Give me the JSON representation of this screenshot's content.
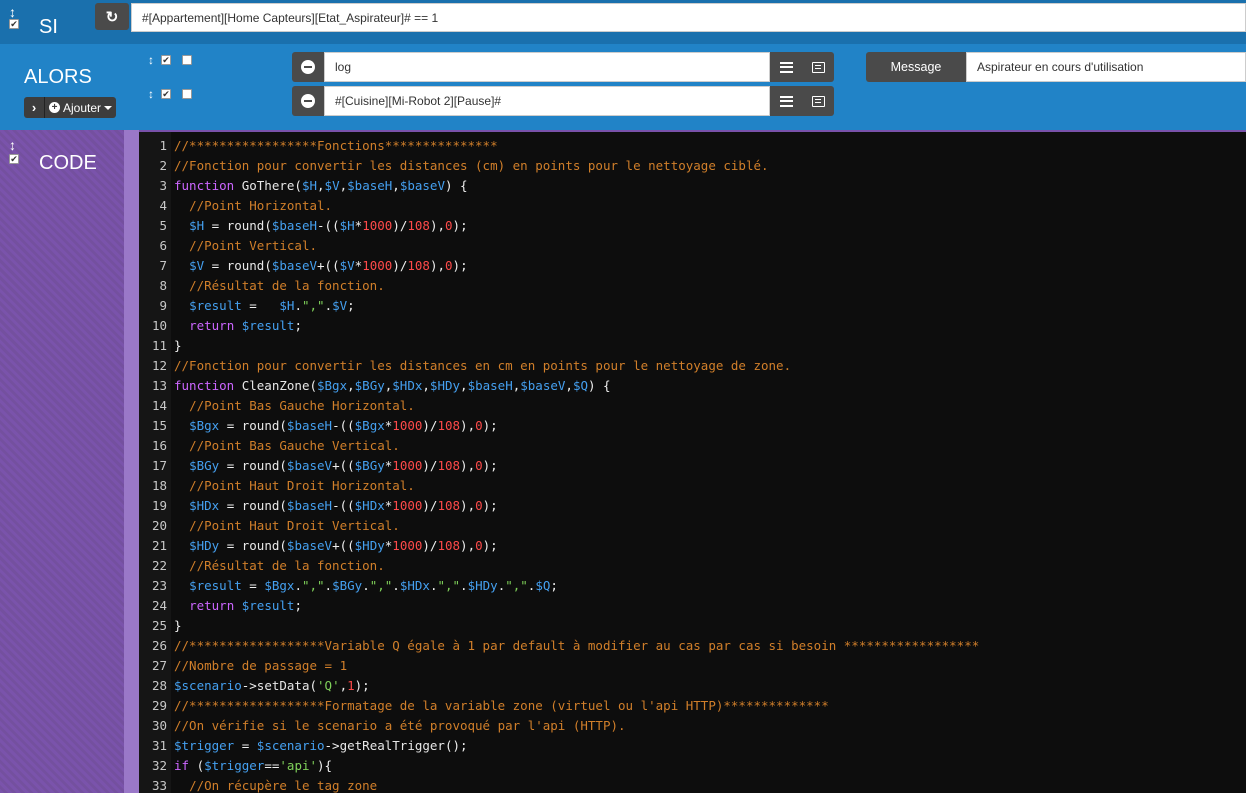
{
  "si": {
    "title": "SI",
    "condition": "#[Appartement][Home Capteurs][Etat_Aspirateur]# == 1"
  },
  "alors": {
    "title": "ALORS",
    "add_label": "Ajouter",
    "actions": [
      {
        "value": "log",
        "option_label": "Message",
        "option_value": "Aspirateur en cours d'utilisation"
      },
      {
        "value": "#[Cuisine][Mi-Robot 2][Pause]#"
      }
    ]
  },
  "code": {
    "title": "CODE",
    "lines": [
      [
        [
          "c",
          "//*****************Fonctions***************"
        ]
      ],
      [
        [
          "c",
          "//Fonction pour convertir les distances (cm) en points pour le nettoyage ciblé."
        ]
      ],
      [
        [
          "k",
          "function "
        ],
        [
          "f",
          "GoThere"
        ],
        [
          "p",
          "("
        ],
        [
          "v",
          "$H"
        ],
        [
          "p",
          ","
        ],
        [
          "v",
          "$V"
        ],
        [
          "p",
          ","
        ],
        [
          "v",
          "$baseH"
        ],
        [
          "p",
          ","
        ],
        [
          "v",
          "$baseV"
        ],
        [
          "p",
          ") {"
        ]
      ],
      [
        [
          "p",
          "  "
        ],
        [
          "c",
          "//Point Horizontal."
        ]
      ],
      [
        [
          "p",
          "  "
        ],
        [
          "v",
          "$H"
        ],
        [
          "p",
          " = "
        ],
        [
          "f",
          "round"
        ],
        [
          "p",
          "("
        ],
        [
          "v",
          "$baseH"
        ],
        [
          "p",
          "-(("
        ],
        [
          "v",
          "$H"
        ],
        [
          "p",
          "*"
        ],
        [
          "n",
          "1000"
        ],
        [
          "p",
          ")/"
        ],
        [
          "n",
          "108"
        ],
        [
          "p",
          "),"
        ],
        [
          "n",
          "0"
        ],
        [
          "p",
          ");"
        ]
      ],
      [
        [
          "p",
          "  "
        ],
        [
          "c",
          "//Point Vertical."
        ]
      ],
      [
        [
          "p",
          "  "
        ],
        [
          "v",
          "$V"
        ],
        [
          "p",
          " = "
        ],
        [
          "f",
          "round"
        ],
        [
          "p",
          "("
        ],
        [
          "v",
          "$baseV"
        ],
        [
          "p",
          "+(("
        ],
        [
          "v",
          "$V"
        ],
        [
          "p",
          "*"
        ],
        [
          "n",
          "1000"
        ],
        [
          "p",
          ")/"
        ],
        [
          "n",
          "108"
        ],
        [
          "p",
          "),"
        ],
        [
          "n",
          "0"
        ],
        [
          "p",
          ");"
        ]
      ],
      [
        [
          "p",
          "  "
        ],
        [
          "c",
          "//Résultat de la fonction."
        ]
      ],
      [
        [
          "p",
          "  "
        ],
        [
          "v",
          "$result"
        ],
        [
          "p",
          " =   "
        ],
        [
          "v",
          "$H"
        ],
        [
          "p",
          "."
        ],
        [
          "s",
          "\",\""
        ],
        [
          "p",
          "."
        ],
        [
          "v",
          "$V"
        ],
        [
          "p",
          ";"
        ]
      ],
      [
        [
          "p",
          "  "
        ],
        [
          "k",
          "return "
        ],
        [
          "v",
          "$result"
        ],
        [
          "p",
          ";"
        ]
      ],
      [
        [
          "p",
          "}"
        ]
      ],
      [
        [
          "c",
          "//Fonction pour convertir les distances en cm en points pour le nettoyage de zone."
        ]
      ],
      [
        [
          "k",
          "function "
        ],
        [
          "f",
          "CleanZone"
        ],
        [
          "p",
          "("
        ],
        [
          "v",
          "$Bgx"
        ],
        [
          "p",
          ","
        ],
        [
          "v",
          "$BGy"
        ],
        [
          "p",
          ","
        ],
        [
          "v",
          "$HDx"
        ],
        [
          "p",
          ","
        ],
        [
          "v",
          "$HDy"
        ],
        [
          "p",
          ","
        ],
        [
          "v",
          "$baseH"
        ],
        [
          "p",
          ","
        ],
        [
          "v",
          "$baseV"
        ],
        [
          "p",
          ","
        ],
        [
          "v",
          "$Q"
        ],
        [
          "p",
          ") {"
        ]
      ],
      [
        [
          "p",
          "  "
        ],
        [
          "c",
          "//Point Bas Gauche Horizontal."
        ]
      ],
      [
        [
          "p",
          "  "
        ],
        [
          "v",
          "$Bgx"
        ],
        [
          "p",
          " = "
        ],
        [
          "f",
          "round"
        ],
        [
          "p",
          "("
        ],
        [
          "v",
          "$baseH"
        ],
        [
          "p",
          "-(("
        ],
        [
          "v",
          "$Bgx"
        ],
        [
          "p",
          "*"
        ],
        [
          "n",
          "1000"
        ],
        [
          "p",
          ")/"
        ],
        [
          "n",
          "108"
        ],
        [
          "p",
          "),"
        ],
        [
          "n",
          "0"
        ],
        [
          "p",
          ");"
        ]
      ],
      [
        [
          "p",
          "  "
        ],
        [
          "c",
          "//Point Bas Gauche Vertical."
        ]
      ],
      [
        [
          "p",
          "  "
        ],
        [
          "v",
          "$BGy"
        ],
        [
          "p",
          " = "
        ],
        [
          "f",
          "round"
        ],
        [
          "p",
          "("
        ],
        [
          "v",
          "$baseV"
        ],
        [
          "p",
          "+(("
        ],
        [
          "v",
          "$BGy"
        ],
        [
          "p",
          "*"
        ],
        [
          "n",
          "1000"
        ],
        [
          "p",
          ")/"
        ],
        [
          "n",
          "108"
        ],
        [
          "p",
          "),"
        ],
        [
          "n",
          "0"
        ],
        [
          "p",
          ");"
        ]
      ],
      [
        [
          "p",
          "  "
        ],
        [
          "c",
          "//Point Haut Droit Horizontal."
        ]
      ],
      [
        [
          "p",
          "  "
        ],
        [
          "v",
          "$HDx"
        ],
        [
          "p",
          " = "
        ],
        [
          "f",
          "round"
        ],
        [
          "p",
          "("
        ],
        [
          "v",
          "$baseH"
        ],
        [
          "p",
          "-(("
        ],
        [
          "v",
          "$HDx"
        ],
        [
          "p",
          "*"
        ],
        [
          "n",
          "1000"
        ],
        [
          "p",
          ")/"
        ],
        [
          "n",
          "108"
        ],
        [
          "p",
          "),"
        ],
        [
          "n",
          "0"
        ],
        [
          "p",
          ");"
        ]
      ],
      [
        [
          "p",
          "  "
        ],
        [
          "c",
          "//Point Haut Droit Vertical."
        ]
      ],
      [
        [
          "p",
          "  "
        ],
        [
          "v",
          "$HDy"
        ],
        [
          "p",
          " = "
        ],
        [
          "f",
          "round"
        ],
        [
          "p",
          "("
        ],
        [
          "v",
          "$baseV"
        ],
        [
          "p",
          "+(("
        ],
        [
          "v",
          "$HDy"
        ],
        [
          "p",
          "*"
        ],
        [
          "n",
          "1000"
        ],
        [
          "p",
          ")/"
        ],
        [
          "n",
          "108"
        ],
        [
          "p",
          "),"
        ],
        [
          "n",
          "0"
        ],
        [
          "p",
          ");"
        ]
      ],
      [
        [
          "p",
          "  "
        ],
        [
          "c",
          "//Résultat de la fonction."
        ]
      ],
      [
        [
          "p",
          "  "
        ],
        [
          "v",
          "$result"
        ],
        [
          "p",
          " = "
        ],
        [
          "v",
          "$Bgx"
        ],
        [
          "p",
          "."
        ],
        [
          "s",
          "\",\""
        ],
        [
          "p",
          "."
        ],
        [
          "v",
          "$BGy"
        ],
        [
          "p",
          "."
        ],
        [
          "s",
          "\",\""
        ],
        [
          "p",
          "."
        ],
        [
          "v",
          "$HDx"
        ],
        [
          "p",
          "."
        ],
        [
          "s",
          "\",\""
        ],
        [
          "p",
          "."
        ],
        [
          "v",
          "$HDy"
        ],
        [
          "p",
          "."
        ],
        [
          "s",
          "\",\""
        ],
        [
          "p",
          "."
        ],
        [
          "v",
          "$Q"
        ],
        [
          "p",
          ";"
        ]
      ],
      [
        [
          "p",
          "  "
        ],
        [
          "k",
          "return "
        ],
        [
          "v",
          "$result"
        ],
        [
          "p",
          ";"
        ]
      ],
      [
        [
          "p",
          "}"
        ]
      ],
      [
        [
          "c",
          "//******************Variable Q égale à 1 par default à modifier au cas par cas si besoin ******************"
        ]
      ],
      [
        [
          "c",
          "//Nombre de passage = 1"
        ]
      ],
      [
        [
          "v",
          "$scenario"
        ],
        [
          "p",
          "->"
        ],
        [
          "f",
          "setData"
        ],
        [
          "p",
          "("
        ],
        [
          "s",
          "'Q'"
        ],
        [
          "p",
          ","
        ],
        [
          "n",
          "1"
        ],
        [
          "p",
          ");"
        ]
      ],
      [
        [
          "c",
          "//******************Formatage de la variable zone (virtuel ou l'api HTTP)**************"
        ]
      ],
      [
        [
          "c",
          "//On vérifie si le scenario a été provoqué par l'api (HTTP)."
        ]
      ],
      [
        [
          "v",
          "$trigger"
        ],
        [
          "p",
          " = "
        ],
        [
          "v",
          "$scenario"
        ],
        [
          "p",
          "->"
        ],
        [
          "f",
          "getRealTrigger"
        ],
        [
          "p",
          "();"
        ]
      ],
      [
        [
          "k",
          "if "
        ],
        [
          "p",
          "("
        ],
        [
          "v",
          "$trigger"
        ],
        [
          "p",
          "=="
        ],
        [
          "s",
          "'api'"
        ],
        [
          "p",
          "){"
        ]
      ],
      [
        [
          "p",
          "  "
        ],
        [
          "c",
          "//On récupère le tag zone"
        ]
      ]
    ]
  }
}
